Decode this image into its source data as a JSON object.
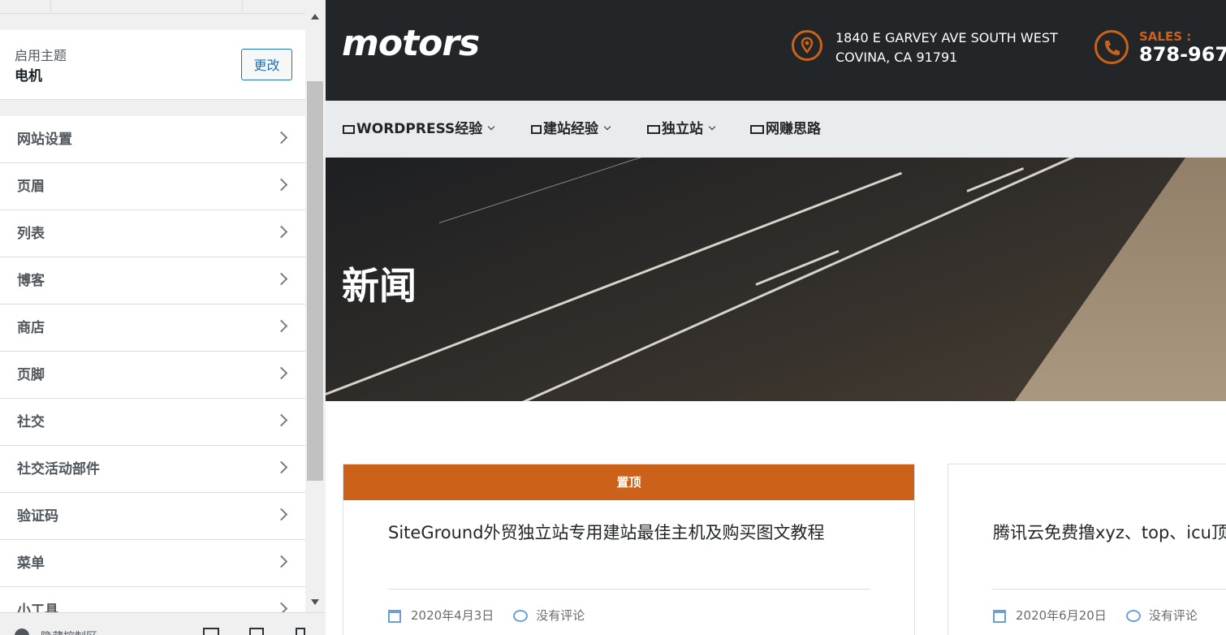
{
  "customizer": {
    "theme_label": "启用主题",
    "theme_name": "电机",
    "change_button": "更改",
    "menu_items": [
      {
        "label": "网站设置"
      },
      {
        "label": "页眉"
      },
      {
        "label": "列表"
      },
      {
        "label": "博客"
      },
      {
        "label": "商店"
      },
      {
        "label": "页脚"
      },
      {
        "label": "社交"
      },
      {
        "label": "社交活动部件"
      },
      {
        "label": "验证码"
      },
      {
        "label": "菜单"
      },
      {
        "label": "小工具"
      }
    ],
    "footer_collapse_label": "隐藏控制区"
  },
  "site": {
    "logo": "motors",
    "address_line1": "1840 E GARVEY AVE SOUTH WEST",
    "address_line2": "COVINA, CA 91791",
    "sales_label": "SALES :",
    "sales_phone": "878-967",
    "brand_color": "#cc6119",
    "nav": [
      {
        "label": "WORDPRESS经验",
        "icon": "monitor-icon",
        "has_dropdown": true
      },
      {
        "label": "建站经验",
        "icon": "book-icon",
        "has_dropdown": true
      },
      {
        "label": "独立站",
        "icon": "server-icon",
        "has_dropdown": true
      },
      {
        "label": "网赚思路",
        "icon": "money-icon",
        "has_dropdown": false
      }
    ],
    "hero_title": "新闻",
    "posts": [
      {
        "sticky_label": "置顶",
        "title": "SiteGround外贸独立站专用建站最佳主机及购买图文教程",
        "date": "2020年4月3日",
        "comments": "没有评论"
      },
      {
        "title": "腾讯云免费撸xyz、top、icu顶",
        "date": "2020年6月20日",
        "comments": "没有评论"
      }
    ]
  }
}
